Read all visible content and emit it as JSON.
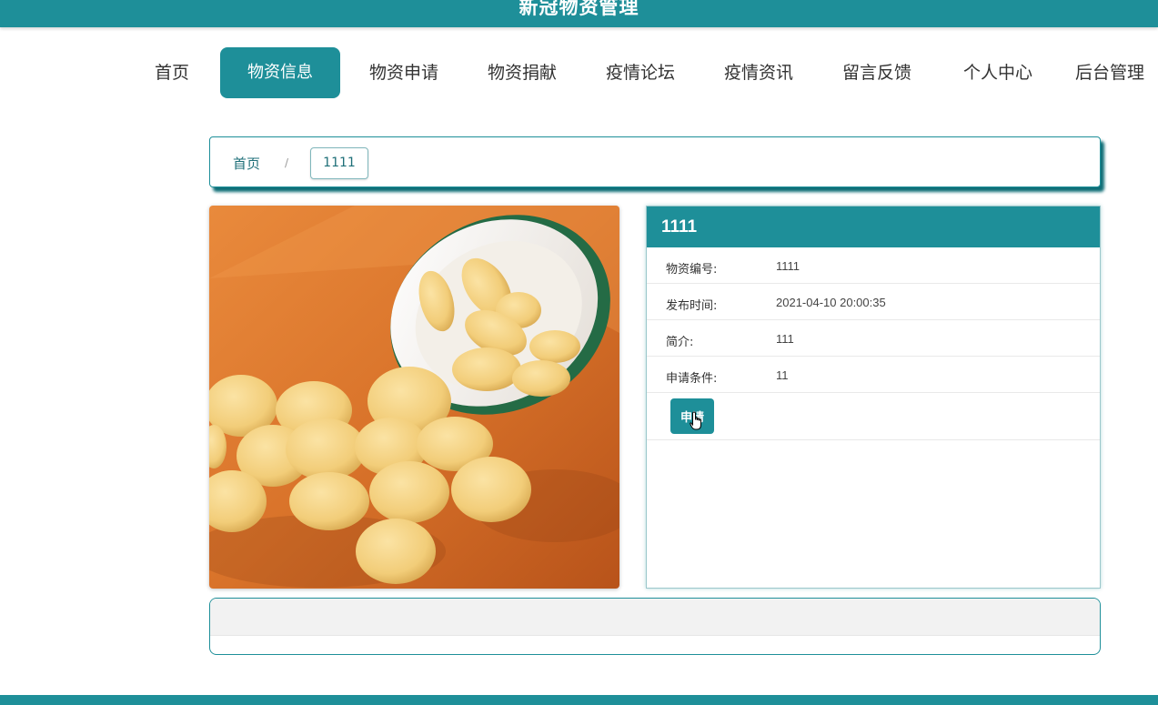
{
  "app": {
    "title": "新冠物资管理"
  },
  "nav": {
    "items": [
      {
        "label": "首页"
      },
      {
        "label": "物资信息",
        "active": true
      },
      {
        "label": "物资申请"
      },
      {
        "label": "物资捐献"
      },
      {
        "label": "疫情论坛"
      },
      {
        "label": "疫情资讯"
      },
      {
        "label": "留言反馈"
      },
      {
        "label": "个人中心"
      },
      {
        "label": "后台管理"
      }
    ]
  },
  "breadcrumb": {
    "home": "首页",
    "separator": "/",
    "current": "1111"
  },
  "detail": {
    "title": "1111",
    "fields": [
      {
        "label": "物资编号:",
        "value": "1111"
      },
      {
        "label": "发布时间:",
        "value": "2021-04-10 20:00:35"
      },
      {
        "label": "简介:",
        "value": "111"
      },
      {
        "label": "申请条件:",
        "value": "11"
      }
    ],
    "apply_label": "申请"
  },
  "image": {
    "subject": "pills-and-bottle-photo"
  },
  "colors": {
    "primary": "#1e8f99",
    "border": "#1e8f99",
    "panel_bg": "#f2f2f2"
  }
}
